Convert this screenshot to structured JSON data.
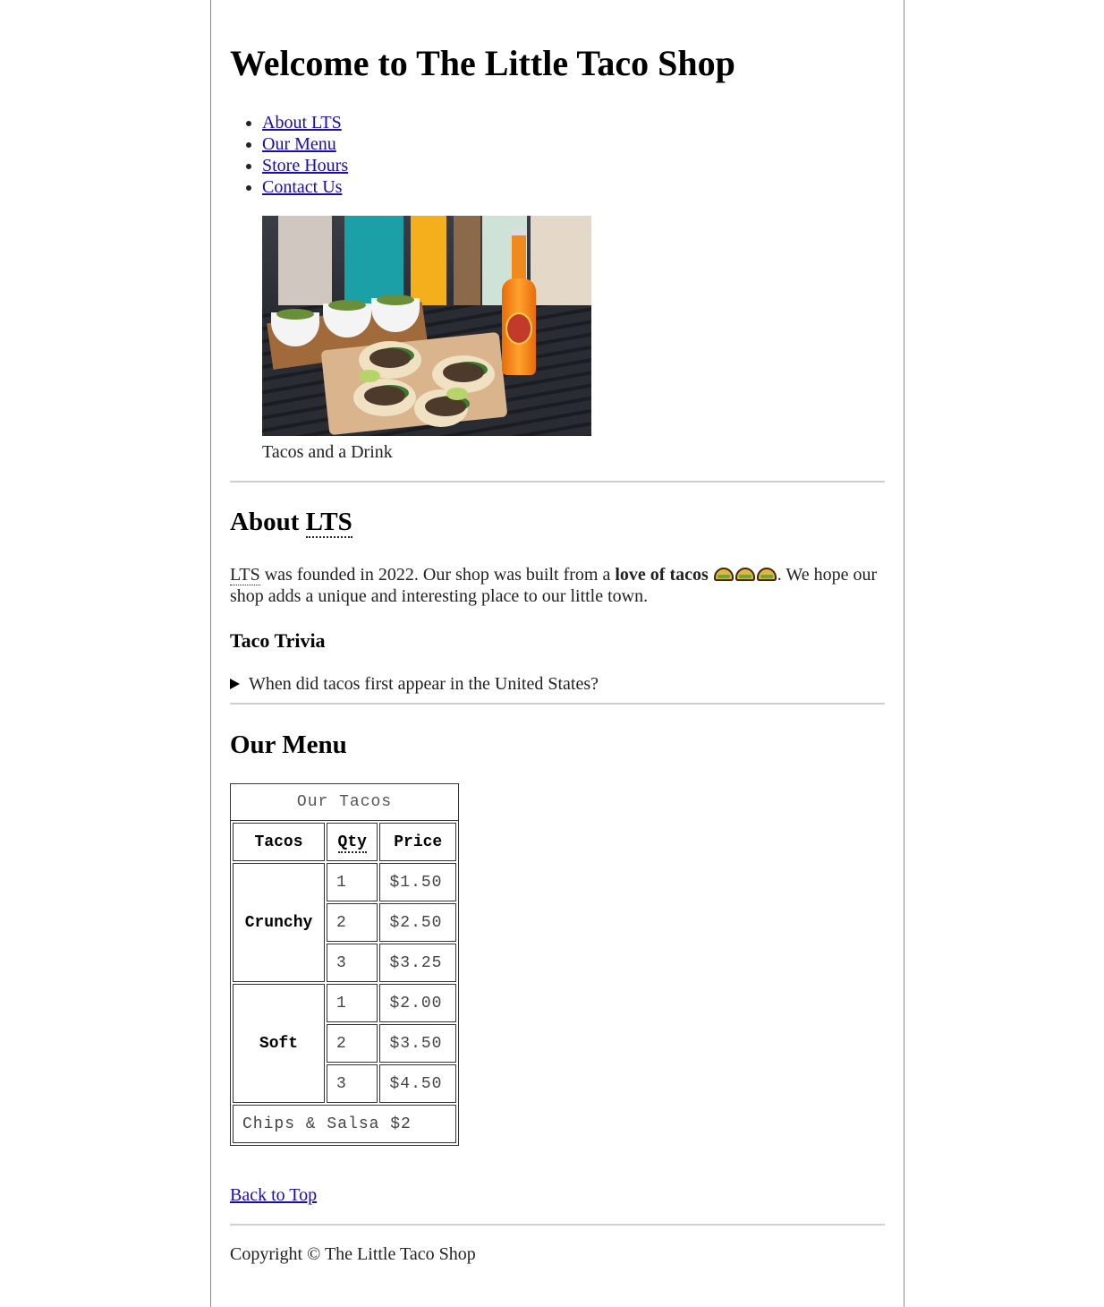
{
  "header": {
    "title": "Welcome to The Little Taco Shop"
  },
  "nav": {
    "items": [
      {
        "label": "About LTS"
      },
      {
        "label": "Our Menu"
      },
      {
        "label": "Store Hours"
      },
      {
        "label": "Contact Us"
      }
    ]
  },
  "figure": {
    "caption": "Tacos and a Drink"
  },
  "about": {
    "heading": "About LTS",
    "abbr": "LTS",
    "text_before_bold": " was founded in 2022. Our shop was built from a ",
    "bold_text": "love of tacos",
    "text_after": ". We hope our shop adds a unique and interesting place to our little town."
  },
  "trivia": {
    "heading": "Taco Trivia",
    "summary": "When did tacos first appear in the United States?"
  },
  "menu": {
    "heading": "Our Menu",
    "caption": "Our Tacos",
    "headers": {
      "tacos": "Tacos",
      "qty": "Qty",
      "price": "Price"
    },
    "groups": [
      {
        "name": "Crunchy",
        "rows": [
          {
            "qty": "1",
            "price": "$1.50"
          },
          {
            "qty": "2",
            "price": "$2.50"
          },
          {
            "qty": "3",
            "price": "$3.25"
          }
        ]
      },
      {
        "name": "Soft",
        "rows": [
          {
            "qty": "1",
            "price": "$2.00"
          },
          {
            "qty": "2",
            "price": "$3.50"
          },
          {
            "qty": "3",
            "price": "$4.50"
          }
        ]
      }
    ],
    "footer": "Chips & Salsa $2"
  },
  "back_to_top": "Back to Top",
  "footer": {
    "copyright": "Copyright © The Little Taco Shop"
  },
  "colors": {
    "link": "#1a0dab",
    "border": "#8a8a8a"
  }
}
